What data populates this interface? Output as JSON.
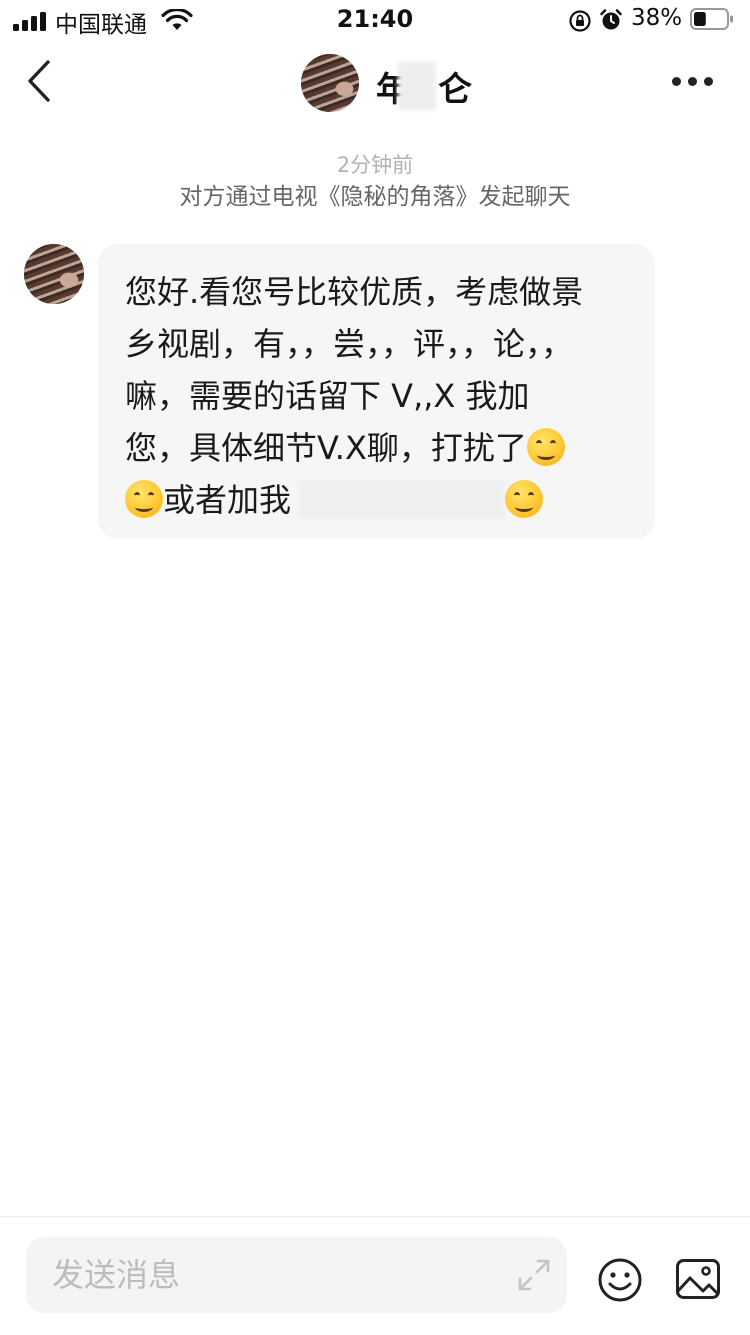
{
  "status_bar": {
    "carrier": "中国联通",
    "time": "21:40",
    "battery_percent": "38%",
    "battery_level": 0.38,
    "signal_bars": 4
  },
  "nav": {
    "title_visible": "年",
    "title_tail": "仑"
  },
  "chat": {
    "time_label": "2分钟前",
    "source_text": "对方通过电视《隐秘的角落》发起聊天",
    "message_lines": [
      "您好.看您号比较优质，考虑做景",
      "乡视剧，有，，尝，，评，，论，，",
      "嘛，需要的话留下  V,,X   我加",
      "您，具体细节V.X聊，打扰了",
      "或者加我"
    ]
  },
  "input": {
    "placeholder": "发送消息"
  },
  "colors": {
    "bubble_bg": "#f6f6f6",
    "time_text": "#b2b2b2",
    "placeholder": "#bcbcbc"
  },
  "icons": [
    "back-arrow-icon",
    "more-icon",
    "expand-icon",
    "emoji-icon",
    "image-icon",
    "smile-emoji-icon"
  ]
}
